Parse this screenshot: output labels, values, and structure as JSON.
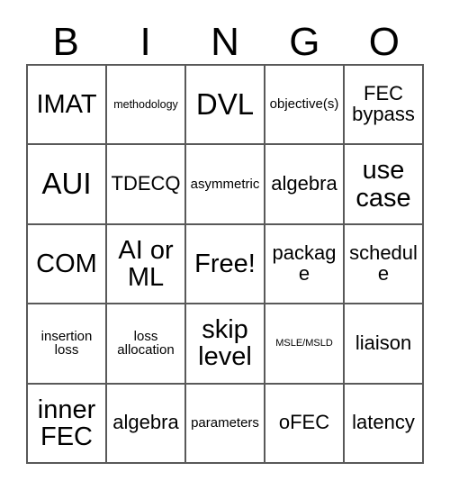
{
  "card": {
    "title": "Bingo Card",
    "header_letters": [
      "B",
      "I",
      "N",
      "G",
      "O"
    ],
    "columns": 5,
    "rows": 5,
    "colors": {
      "background": "#ffffff",
      "grid_line": "#595959",
      "text": "#000000"
    },
    "free_space": "Free!",
    "free_space_position": {
      "row": 3,
      "column": 3
    },
    "cells": [
      {
        "row": 1,
        "column": 1,
        "column_letter": "B",
        "text": "IMAT",
        "size": "lg"
      },
      {
        "row": 1,
        "column": 2,
        "column_letter": "I",
        "text": "methodology",
        "size": "xs"
      },
      {
        "row": 1,
        "column": 3,
        "column_letter": "N",
        "text": "DVL",
        "size": "xl"
      },
      {
        "row": 1,
        "column": 4,
        "column_letter": "G",
        "text": "objective(s)",
        "size": "sm"
      },
      {
        "row": 1,
        "column": 5,
        "column_letter": "O",
        "text": "FEC bypass",
        "size": "md"
      },
      {
        "row": 2,
        "column": 1,
        "column_letter": "B",
        "text": "AUI",
        "size": "xl"
      },
      {
        "row": 2,
        "column": 2,
        "column_letter": "I",
        "text": "TDECQ",
        "size": "md"
      },
      {
        "row": 2,
        "column": 3,
        "column_letter": "N",
        "text": "asymmetric",
        "size": "sm"
      },
      {
        "row": 2,
        "column": 4,
        "column_letter": "G",
        "text": "algebra",
        "size": "md"
      },
      {
        "row": 2,
        "column": 5,
        "column_letter": "O",
        "text": "use case",
        "size": "lg"
      },
      {
        "row": 3,
        "column": 1,
        "column_letter": "B",
        "text": "COM",
        "size": "lg"
      },
      {
        "row": 3,
        "column": 2,
        "column_letter": "I",
        "text": "AI or ML",
        "size": "lg"
      },
      {
        "row": 3,
        "column": 3,
        "column_letter": "N",
        "text": "Free!",
        "size": "lg"
      },
      {
        "row": 3,
        "column": 4,
        "column_letter": "G",
        "text": "package",
        "size": "md"
      },
      {
        "row": 3,
        "column": 5,
        "column_letter": "O",
        "text": "schedule",
        "size": "md"
      },
      {
        "row": 4,
        "column": 1,
        "column_letter": "B",
        "text": "insertion loss",
        "size": "sm"
      },
      {
        "row": 4,
        "column": 2,
        "column_letter": "I",
        "text": "loss allocation",
        "size": "sm"
      },
      {
        "row": 4,
        "column": 3,
        "column_letter": "N",
        "text": "skip level",
        "size": "lg"
      },
      {
        "row": 4,
        "column": 4,
        "column_letter": "G",
        "text": "MSLE/MSLD",
        "size": "xxs"
      },
      {
        "row": 4,
        "column": 5,
        "column_letter": "O",
        "text": "liaison",
        "size": "md"
      },
      {
        "row": 5,
        "column": 1,
        "column_letter": "B",
        "text": "inner FEC",
        "size": "lg"
      },
      {
        "row": 5,
        "column": 2,
        "column_letter": "I",
        "text": "algebra",
        "size": "md"
      },
      {
        "row": 5,
        "column": 3,
        "column_letter": "N",
        "text": "parameters",
        "size": "sm"
      },
      {
        "row": 5,
        "column": 4,
        "column_letter": "G",
        "text": "oFEC",
        "size": "md"
      },
      {
        "row": 5,
        "column": 5,
        "column_letter": "O",
        "text": "latency",
        "size": "md"
      }
    ]
  }
}
